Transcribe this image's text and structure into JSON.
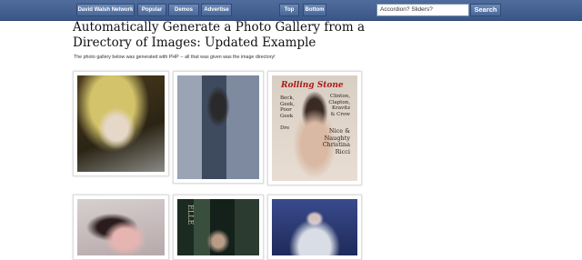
{
  "nav": {
    "buttons": [
      "David Walsh Network",
      "Popular",
      "Demos",
      "Advertise"
    ],
    "center_buttons": [
      "Top",
      "Bottom"
    ]
  },
  "search": {
    "value": "Accordion? Sliders?",
    "button_label": "Search"
  },
  "main": {
    "title": "Automatically Generate a Photo Gallery from a Directory of Images: Updated Example",
    "intro": "The photo gallery below was generated with PHP -- all that was given was the image directory!"
  },
  "gallery": {
    "cover_logo": "Rolling Stone",
    "cover_left": "Beck,\nGeek,\nPoor\nGeek\n\nDre",
    "cover_right": "Clinton,\nClapton,\nKravitz\n& Crow",
    "cover_right_lower": "Nice &\nNaughty\nChristina\nRicci",
    "spine_text": "ELLE"
  },
  "colors": {
    "topbar": "#3b5787",
    "button": "#4a6897",
    "title": "#111111"
  }
}
